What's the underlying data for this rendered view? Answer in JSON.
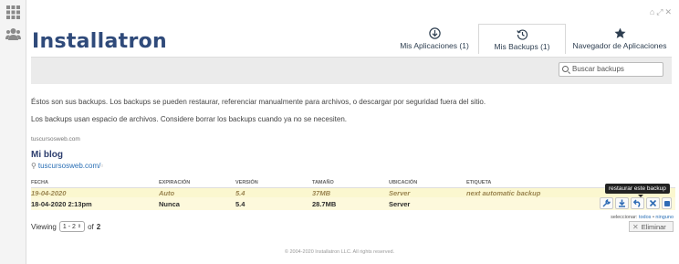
{
  "app": {
    "logo": "Installatron"
  },
  "tabs": [
    {
      "label": "Mis Aplicaciones (1)",
      "icon": "download-circle-icon",
      "active": false
    },
    {
      "label": "Mis Backups (1)",
      "icon": "backup-history-icon",
      "active": true
    },
    {
      "label": "Navegador de Aplicaciones",
      "icon": "star-icon",
      "active": false
    }
  ],
  "search": {
    "placeholder": "Buscar backups"
  },
  "intro": {
    "line1": "Éstos son sus backups. Los backups se pueden restaurar, referenciar manualmente para archivos, o descargar por seguridad fuera del sitio.",
    "line2": "Los backups usan espacio de archivos. Considere borrar los backups cuando ya no se necesiten."
  },
  "site": {
    "domain": "tuscursosweb.com",
    "app_title": "Mi blog",
    "link": "tuscursosweb.com/"
  },
  "table": {
    "headers": [
      "FECHA",
      "EXPIRACIÓN",
      "VERSIÓN",
      "TAMAÑO",
      "UBICACIÓN",
      "ETIQUETA"
    ],
    "rows": [
      [
        "19-04-2020",
        "Auto",
        "5.4",
        "37MB",
        "Server",
        "next automatic backup"
      ],
      [
        "18-04-2020 2:13pm",
        "Nunca",
        "5.4",
        "28.7MB",
        "Server",
        ""
      ]
    ]
  },
  "actions": {
    "tooltip": "restaurar este backup",
    "select_label": "seleccionar:",
    "select_all": "todos",
    "select_none": "ninguno"
  },
  "pagination": {
    "viewing": "Viewing",
    "range": "1 - 2",
    "of": "of",
    "total": "2"
  },
  "delete_button": "Eliminar",
  "footer": "© 2004-2020 Installatron LLC. All rights reserved.",
  "colors": {
    "accent": "#2f6cb5",
    "logo": "#2f4a7a",
    "row_highlight": "#fbf7cf"
  }
}
